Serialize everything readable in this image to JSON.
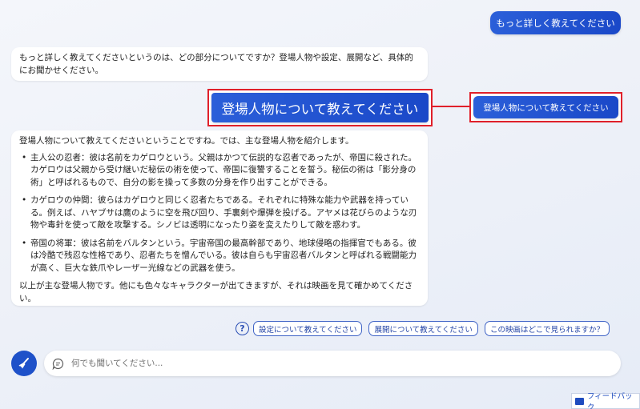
{
  "user_messages": {
    "top": "もっと詳しく教えてください",
    "current_zoom": "登場人物について教えてください",
    "current": "登場人物について教えてください"
  },
  "bot_messages": {
    "first": "もっと詳しく教えてくださいというのは、どの部分についてですか？登場人物や設定、展開など、具体的にお聞かせください。",
    "second_intro": "登場人物について教えてくださいということですね。では、主な登場人物を紹介します。",
    "second_items": [
      "主人公の忍者：彼は名前をカゲロウという。父親はかつて伝説的な忍者であったが、帝国に殺された。カゲロウは父親から受け継いだ秘伝の術を使って、帝国に復讐することを誓う。秘伝の術は「影分身の術」と呼ばれるもので、自分の影を操って多数の分身を作り出すことができる。",
      "カゲロウの仲間：彼らはカゲロウと同じく忍者たちである。それぞれに特殊な能力や武器を持っている。例えば、ハヤブサは鷹のように空を飛び回り、手裏剣や爆弾を投げる。アヤメは花びらのような刃物や毒針を使って敵を攻撃する。シノビは透明になったり姿を変えたりして敵を惑わす。",
      "帝国の将軍：彼は名前をバルタンという。宇宙帝国の最高幹部であり、地球侵略の指揮官でもある。彼は冷酷で残忍な性格であり、忍者たちを憎んでいる。彼は自らも宇宙忍者バルタンと呼ばれる戦闘能力が高く、巨大な鉄爪やレーザー光線などの武器を使う。"
    ],
    "second_outro": "以上が主な登場人物です。他にも色々なキャラクターが出てきますが、それは映画を見て確かめてください。"
  },
  "suggestions": {
    "icon": "question-circle-icon",
    "items": [
      "設定について教えてください",
      "展開について教えてください",
      "この映画はどこで見られますか？"
    ]
  },
  "composer": {
    "new_topic_icon": "broom-icon",
    "chat_icon": "chat-bubble-icon",
    "placeholder": "何でも聞いてください..."
  },
  "feedback": {
    "label": "フィードバック",
    "icon": "feedback-icon"
  },
  "colors": {
    "user_bubble": "#1f4fd0",
    "highlight_border": "#e0202a",
    "chip_border": "#3f63c6"
  }
}
